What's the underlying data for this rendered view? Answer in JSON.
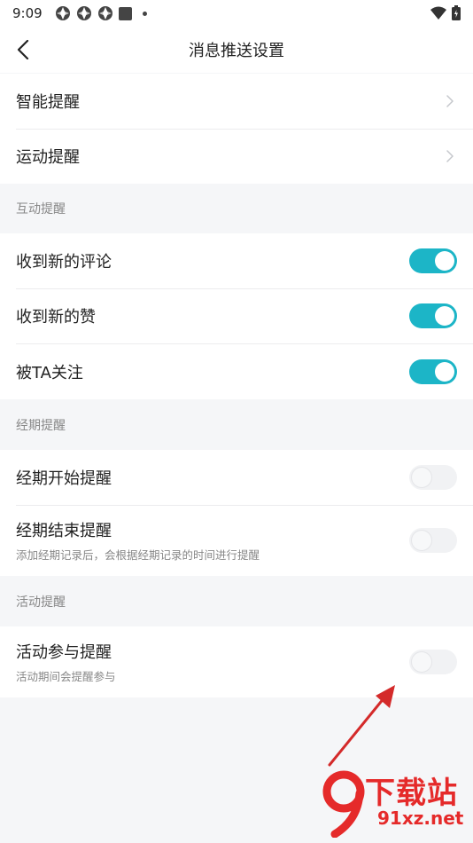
{
  "status_bar": {
    "time": "9:09"
  },
  "header": {
    "title": "消息推送设置"
  },
  "group1": {
    "items": [
      {
        "label": "智能提醒"
      },
      {
        "label": "运动提醒"
      }
    ]
  },
  "interaction": {
    "section_label": "互动提醒",
    "items": [
      {
        "label": "收到新的评论",
        "enabled": true
      },
      {
        "label": "收到新的赞",
        "enabled": true
      },
      {
        "label": "被TA关注",
        "enabled": true
      }
    ]
  },
  "period": {
    "section_label": "经期提醒",
    "items": [
      {
        "label": "经期开始提醒",
        "enabled": false
      },
      {
        "label": "经期结束提醒",
        "sub": "添加经期记录后，会根据经期记录的时间进行提醒",
        "enabled": false
      }
    ]
  },
  "activity": {
    "section_label": "活动提醒",
    "items": [
      {
        "label": "活动参与提醒",
        "sub": "活动期间会提醒参与",
        "enabled": false
      }
    ]
  },
  "watermark": {
    "line1": "下载站",
    "line2": "91xz.net"
  },
  "colors": {
    "toggle_on": "#1cb5c7",
    "toggle_off": "#f1f2f4",
    "annotation_arrow": "#d42a2a",
    "page_bg": "#f5f6f8"
  }
}
